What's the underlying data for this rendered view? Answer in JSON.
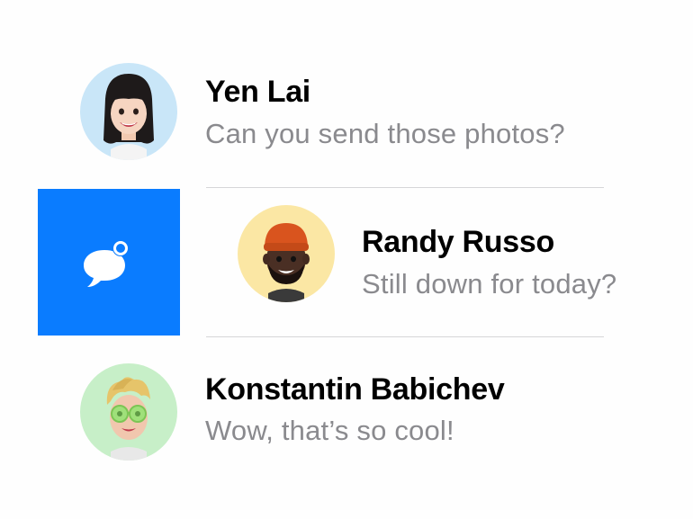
{
  "conversations": [
    {
      "name": "Yen Lai",
      "preview": "Can you send those photos?",
      "avatar_bg": "#c9e6f8",
      "avatar_icon": "memoji-woman-icon"
    },
    {
      "name": "Randy Russo",
      "preview": "Still down for today?",
      "avatar_bg": "#fbe7a4",
      "avatar_icon": "memoji-man-beanie-icon"
    },
    {
      "name": "Konstantin Babichev",
      "preview": "Wow, that’s so cool!",
      "avatar_bg": "#c7efc8",
      "avatar_icon": "memoji-man-sunglasses-icon"
    }
  ],
  "swipe_action": {
    "icon": "mark-unread-icon",
    "color": "#0a7cff"
  }
}
